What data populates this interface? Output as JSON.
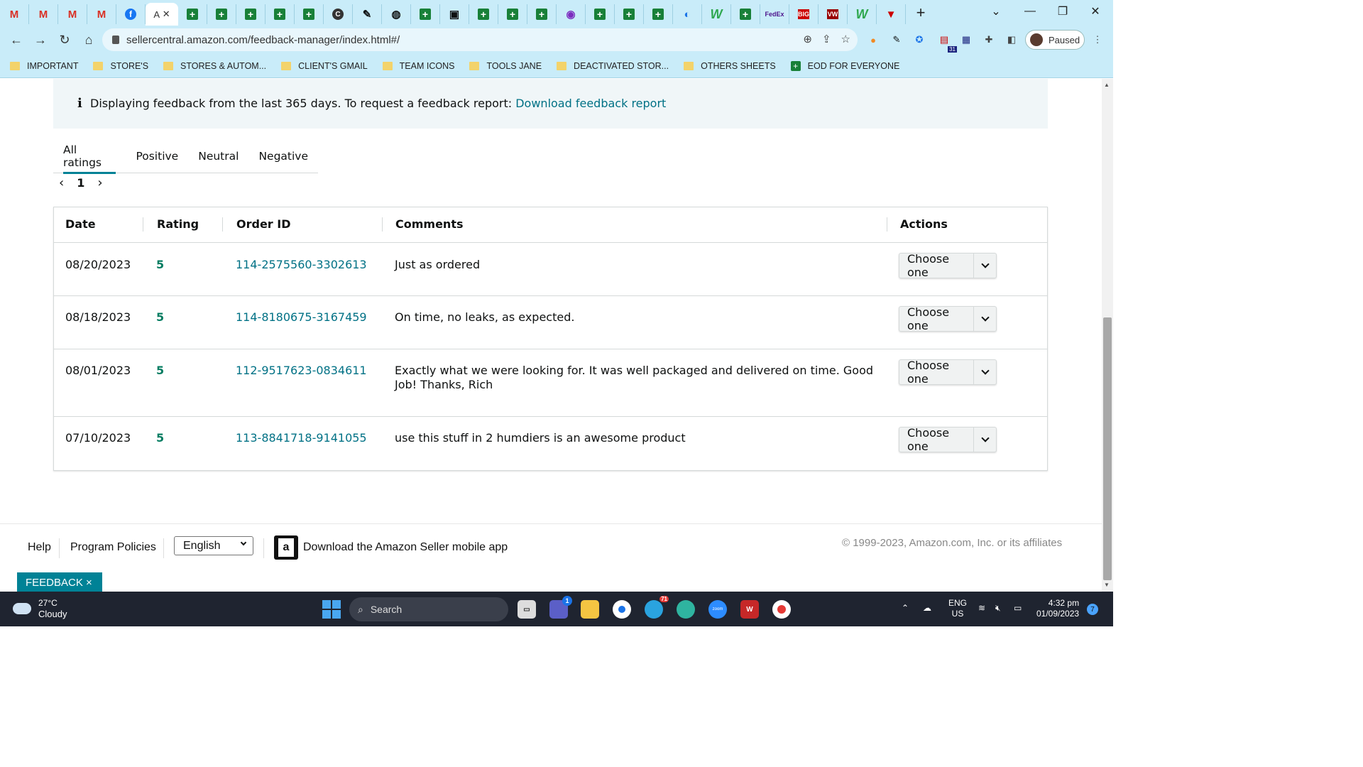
{
  "browser": {
    "active_tab_title": "A",
    "url": "sellercentral.amazon.com/feedback-manager/index.html#/",
    "profile_label": "Paused",
    "calendar_badge": "31",
    "bookmarks": [
      {
        "label": "IMPORTANT",
        "type": "folder"
      },
      {
        "label": "STORE'S",
        "type": "folder"
      },
      {
        "label": "STORES & AUTOM...",
        "type": "folder"
      },
      {
        "label": "CLIENT'S GMAIL",
        "type": "folder"
      },
      {
        "label": "TEAM ICONS",
        "type": "folder"
      },
      {
        "label": "TOOLS JANE",
        "type": "folder"
      },
      {
        "label": "DEACTIVATED STOR...",
        "type": "folder"
      },
      {
        "label": "OTHERS SHEETS",
        "type": "folder"
      },
      {
        "label": "EOD FOR EVERYONE",
        "type": "sheet"
      }
    ]
  },
  "info": {
    "icon": "info-icon",
    "text": "Displaying feedback from the last 365 days. To request a feedback report:",
    "link": "Download feedback report"
  },
  "rating_tabs": [
    "All ratings",
    "Positive",
    "Neutral",
    "Negative"
  ],
  "pagination": {
    "current_page": "1"
  },
  "table": {
    "headers": {
      "date": "Date",
      "rating": "Rating",
      "order_id": "Order ID",
      "comments": "Comments",
      "actions": "Actions"
    },
    "rows": [
      {
        "date": "08/20/2023",
        "rating": "5",
        "order_id": "114-2575560-3302613",
        "comment": "Just as ordered",
        "action": "Choose one"
      },
      {
        "date": "08/18/2023",
        "rating": "5",
        "order_id": "114-8180675-3167459",
        "comment": "On time, no leaks, as expected.",
        "action": "Choose one"
      },
      {
        "date": "08/01/2023",
        "rating": "5",
        "order_id": "112-9517623-0834611",
        "comment": "Exactly what we were looking for. It was well packaged and delivered on time. Good Job! Thanks, Rich",
        "action": "Choose one"
      },
      {
        "date": "07/10/2023",
        "rating": "5",
        "order_id": "113-8841718-9141055",
        "comment": "use this stuff in 2 humdiers is an awesome product",
        "action": "Choose one"
      }
    ]
  },
  "footer": {
    "help": "Help",
    "policies": "Program Policies",
    "language": "English",
    "app_text": "Download the Amazon Seller mobile app",
    "app_logo_letter": "a",
    "copyright": "© 1999-2023, Amazon.com, Inc. or its affiliates",
    "feedback_tab": "FEEDBACK ×"
  },
  "taskbar": {
    "temperature": "27°C",
    "weather": "Cloudy",
    "search_placeholder": "Search",
    "language_line1": "ENG",
    "language_line2": "US",
    "time": "4:32 pm",
    "date": "01/09/2023",
    "notification_count": "7",
    "teams_badge": "1",
    "telegram_badge": "71",
    "zoom_label": "zoom"
  },
  "colors": {
    "accent": "#008296",
    "link": "#007185",
    "rating_green": "#067d62",
    "chrome_blue": "#c9ecf9"
  }
}
